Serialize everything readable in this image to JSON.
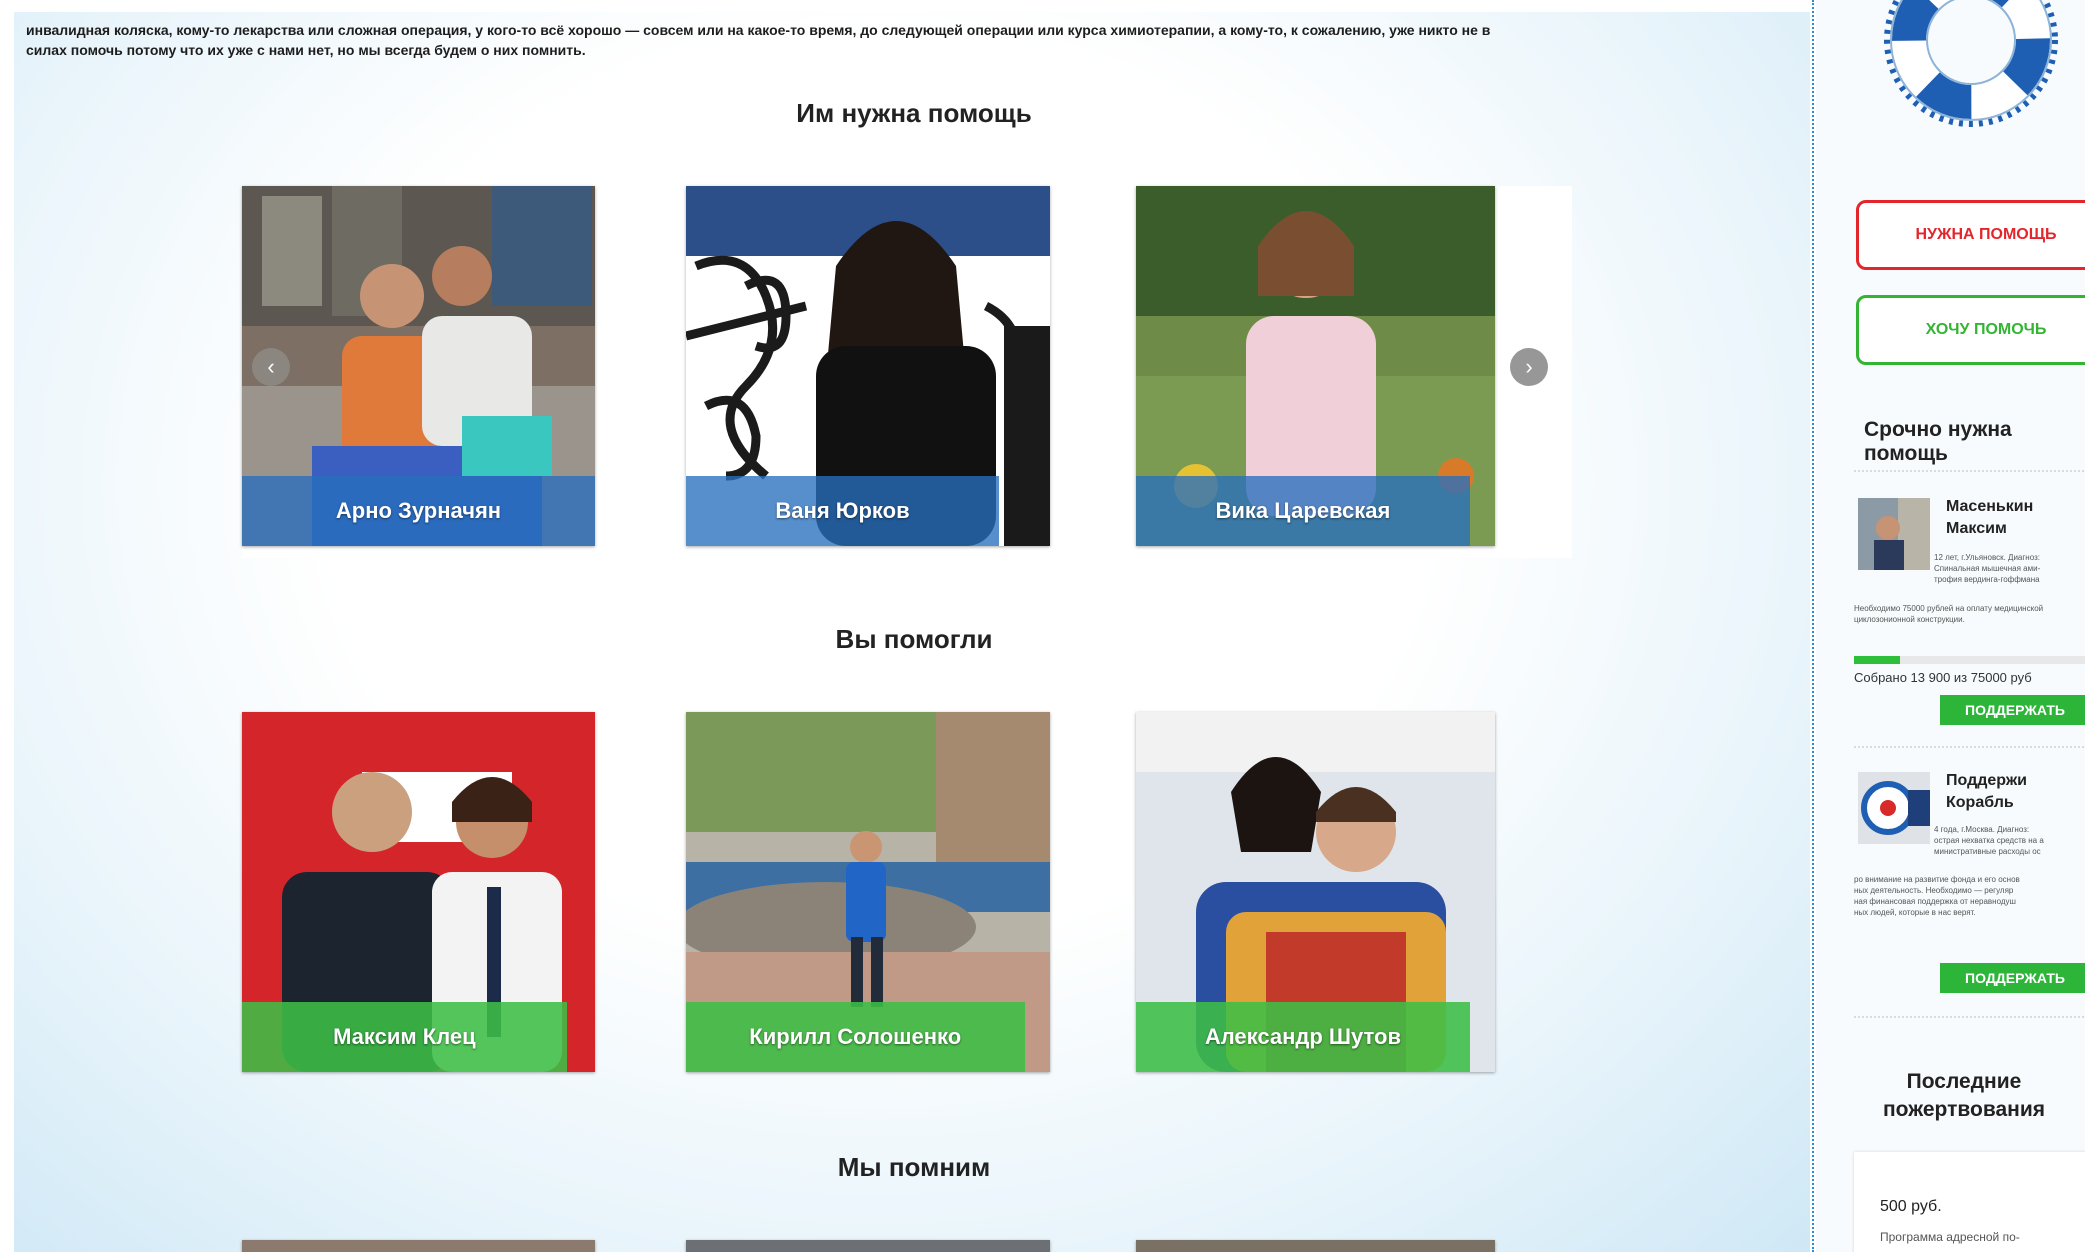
{
  "intro": {
    "line1": "инвалидная коляска, кому-то лекарства или сложная операция, у кого-то всё хорошо — совсем или на какое-то время, до следующей операции или курса химиотерапии, а кому-то, к сожалению, уже никто не в",
    "line2": "силах помочь потому что их уже с нами нет, но мы всегда будем о них помнить."
  },
  "sections": {
    "need_help": "Им нужна помощь",
    "helped": "Вы помогли",
    "remember": "Мы помним"
  },
  "need_help_cards": [
    {
      "name": "Арно Зурначян"
    },
    {
      "name": "Ваня Юрков"
    },
    {
      "name": "Вика Царевская"
    }
  ],
  "helped_cards": [
    {
      "name": "Максим Клец"
    },
    {
      "name": "Кирилл Солошенко"
    },
    {
      "name": "Александр Шутов"
    }
  ],
  "carousel": {
    "prev": "‹",
    "next": "›"
  },
  "sidebar": {
    "need_help_button": "НУЖНА ПОМОЩЬ",
    "want_help_button": "ХОЧУ ПОМОЧЬ",
    "urgent_title": "Срочно нужна помощь",
    "urgent": [
      {
        "name_line1": "Масенькин",
        "name_line2": "Максим",
        "desc1": "12 лет, г.Ульяновск. Диагноз:",
        "desc2": "Спинальная мышечная ами-",
        "desc3": "трофия вердинга-гоффмана",
        "desc4": "Необходимо 75000 рублей на оплату медицинской",
        "desc5": "циклозонионной конструкции.",
        "collected": "Собрано 13 900 из 75000 руб",
        "progress": 0.185,
        "button": "ПОДДЕРЖАТЬ"
      },
      {
        "name_line1": "Поддержи",
        "name_line2": "Корабль",
        "desc1": "4 года, г.Москва. Диагноз:",
        "desc2": "острая нехватка средств на а",
        "desc3": "министративные расходы ос",
        "desc4": "ро внимание на развитие фонда и его основ",
        "desc5": "ных деятельность. Необходимо — регуляр",
        "desc6": "ная финансовая поддержка от неравнодуш",
        "desc7": "ных людей, которые в нас верят.",
        "button": "ПОДДЕРЖАТЬ"
      }
    ],
    "donations_title_1": "Последние",
    "donations_title_2": "пожертвования",
    "donation_amount": "500 руб.",
    "donation_note": "Программа адресной по-"
  },
  "colors": {
    "accent_red": "#e3262c",
    "accent_green": "#33b533",
    "caption_blue": "#286ebe",
    "caption_green": "#3cbe46",
    "divider_blue": "#2a8fd8"
  }
}
